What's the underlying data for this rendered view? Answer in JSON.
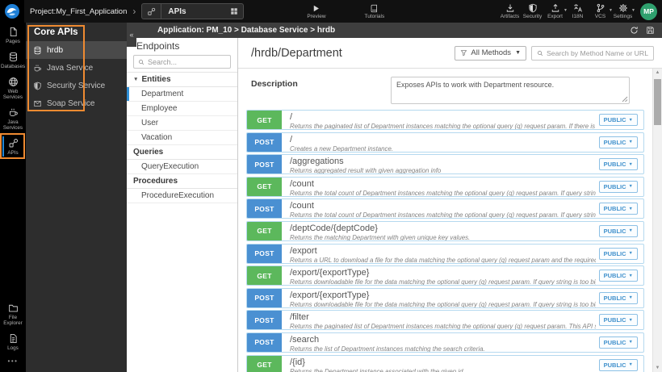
{
  "topbar": {
    "project_label": "Project:My_First_Application",
    "selector_label": "APIs",
    "preview_label": "Preview",
    "tutorials_label": "Tutorials",
    "right_items": [
      {
        "label": "Artifacts",
        "icon": "download-icon",
        "has_caret": false
      },
      {
        "label": "Security",
        "icon": "shield-icon",
        "has_caret": false
      },
      {
        "label": "Export",
        "icon": "upload-icon",
        "has_caret": true
      },
      {
        "label": "I18N",
        "icon": "translate-icon",
        "has_caret": false
      },
      {
        "label": "VCS",
        "icon": "branch-icon",
        "has_caret": true
      },
      {
        "label": "Settings",
        "icon": "gear-icon",
        "has_caret": true
      }
    ],
    "avatar_initials": "MP"
  },
  "sidebar": {
    "items_top": [
      {
        "label": "Pages",
        "icon": "pages-icon",
        "selected": false,
        "annotated": false
      },
      {
        "label": "Databases",
        "icon": "database-icon",
        "selected": false,
        "annotated": false
      },
      {
        "label": "Web Services",
        "icon": "globe-icon",
        "selected": false,
        "annotated": false
      },
      {
        "label": "Java Services",
        "icon": "coffee-icon",
        "selected": false,
        "annotated": false
      },
      {
        "label": "APIs",
        "icon": "api-icon",
        "selected": true,
        "annotated": true
      }
    ],
    "items_bottom": [
      {
        "label": "File Explorer",
        "icon": "folder-icon"
      },
      {
        "label": "Logs",
        "icon": "log-icon"
      }
    ],
    "more_label": "•••"
  },
  "core_apis": {
    "title": "Core APIs",
    "items": [
      {
        "label": "hrdb",
        "icon": "database-icon",
        "selected": true
      },
      {
        "label": "Java Service",
        "icon": "coffee-icon",
        "selected": false
      },
      {
        "label": "Security Service",
        "icon": "shield-icon",
        "selected": false
      },
      {
        "label": "Soap Service",
        "icon": "soap-icon",
        "selected": false
      }
    ],
    "annotation_color": "#ee8a31"
  },
  "breadcrumb": {
    "text": "Application: PM_10 > Database Service > hrdb",
    "collapse_glyph": "«"
  },
  "endpoints": {
    "title": "Endpoints",
    "search_placeholder": "Search...",
    "sections": [
      {
        "label": "Entities",
        "has_caret": true,
        "items": [
          {
            "label": "Department",
            "selected": true
          },
          {
            "label": "Employee",
            "selected": false
          },
          {
            "label": "User",
            "selected": false
          },
          {
            "label": "Vacation",
            "selected": false
          }
        ]
      },
      {
        "label": "Queries",
        "has_caret": false,
        "items": [
          {
            "label": "QueryExecution",
            "selected": false
          }
        ]
      },
      {
        "label": "Procedures",
        "has_caret": false,
        "items": [
          {
            "label": "ProcedureExecution",
            "selected": false
          }
        ]
      }
    ]
  },
  "main": {
    "title": "/hrdb/Department",
    "methods_filter_label": "All Methods",
    "search_placeholder": "Search by Method Name or URL...",
    "description_label": "Description",
    "description_value": "Exposes APIs to work with Department resource.",
    "access_label": "PUBLIC",
    "colors": {
      "get": "#5cb85c",
      "post": "#4a90d2",
      "row_border": "#b5d9ef"
    },
    "endpoints": [
      {
        "method": "GET",
        "path": "/",
        "desc": "Returns the paginated list of Department instances matching the optional query (q) request param. If there is no query pro..."
      },
      {
        "method": "POST",
        "path": "/",
        "desc": "Creates a new Department instance."
      },
      {
        "method": "POST",
        "path": "/aggregations",
        "desc": "Returns aggregated result with given aggregation info"
      },
      {
        "method": "GET",
        "path": "/count",
        "desc": "Returns the total count of Department instances matching the optional query (q) request param. If query string is too big t..."
      },
      {
        "method": "POST",
        "path": "/count",
        "desc": "Returns the total count of Department instances matching the optional query (q) request param. If query string is too big t..."
      },
      {
        "method": "GET",
        "path": "/deptCode/{deptCode}",
        "desc": "Returns the matching Department with given unique key values."
      },
      {
        "method": "POST",
        "path": "/export",
        "desc": "Returns a URL to download a file for the data matching the optional query (q) request param and the required fields provid..."
      },
      {
        "method": "GET",
        "path": "/export/{exportType}",
        "desc": "Returns downloadable file for the data matching the optional query (q) request param. If query string is too big to fit in GET..."
      },
      {
        "method": "POST",
        "path": "/export/{exportType}",
        "desc": "Returns downloadable file for the data matching the optional query (q) request param. If query string is too big to fit in GET..."
      },
      {
        "method": "POST",
        "path": "/filter",
        "desc": "Returns the paginated list of Department instances matching the optional query (q) request param. This API should be use..."
      },
      {
        "method": "POST",
        "path": "/search",
        "desc": "Returns the list of Department instances matching the search criteria."
      },
      {
        "method": "GET",
        "path": "/{id}",
        "desc": "Returns the Department instance associated with the given id."
      }
    ]
  }
}
